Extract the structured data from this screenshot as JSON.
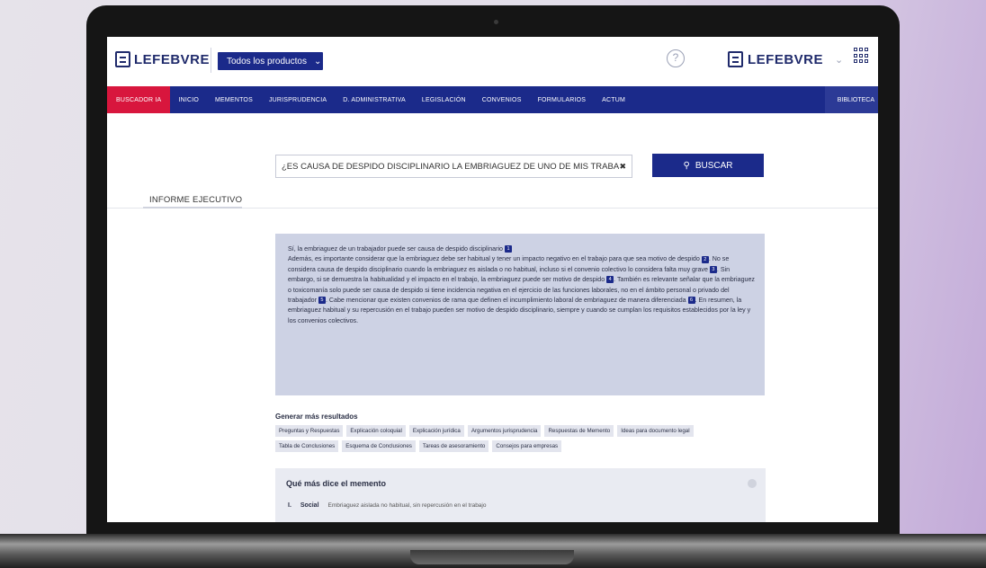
{
  "header": {
    "logo_text": "LEFEBVRE",
    "products_button": "Todos los productos",
    "help_icon": "question-icon",
    "right_logo_text": "LEFEBVRE",
    "apps_icon": "grid-icon"
  },
  "nav": {
    "items": [
      "BUSCADOR IA",
      "INICIO",
      "MEMENTOS",
      "JURISPRUDENCIA",
      "D. ADMINISTRATIVA",
      "LEGISLACIÓN",
      "CONVENIOS",
      "FORMULARIOS",
      "ACTUM"
    ],
    "right": "BIBLIOTECA"
  },
  "search": {
    "value": "¿ES CAUSA DE DESPIDO DISCIPLINARIO LA EMBRIAGUEZ DE UNO DE MIS TRABA",
    "button": "BUSCAR"
  },
  "section_title": "INFORME EJECUTIVO",
  "report": {
    "p1": "Sí, la embriaguez de un trabajador puede ser causa de despido disciplinario",
    "p2": "Además, es importante considerar que la embriaguez debe ser habitual y tener un impacto negativo en el trabajo para que sea motivo de despido",
    "p3": "No se considera causa de despido disciplinario cuando la embriaguez es aislada o no habitual, incluso si el convenio colectivo lo considera falta muy grave",
    "p4": "Sin embargo, si se demuestra la habitualidad y el impacto en el trabajo, la embriaguez puede ser motivo de despido",
    "p5": "También es relevante señalar que la embriaguez o toxicomanía solo puede ser causa de despido si tiene incidencia negativa en el ejercicio de las funciones laborales, no en el ámbito personal o privado del trabajador",
    "p6": "Cabe mencionar que existen convenios de rama que definen el incumplimiento laboral de embriaguez de manera diferenciada",
    "p7": "En resumen, la embriaguez habitual y su repercusión en el trabajo pueden ser motivo de despido disciplinario, siempre y cuando se cumplan los requisitos establecidos por la ley y los convenios colectivos."
  },
  "generate": {
    "title": "Generar más resultados",
    "chips": [
      "Preguntas y Respuestas",
      "Explicación coloquial",
      "Explicación jurídica",
      "Argumentos jurisprudencia",
      "Respuestas de Memento",
      "Ideas para documento legal",
      "Tabla de Conclusiones",
      "Esquema de Conclusiones",
      "Tareas de asesoramiento",
      "Consejos para empresas"
    ]
  },
  "memento": {
    "title": "Qué más dice el memento",
    "row_num": "I.",
    "row_label": "Social",
    "row_text": "Embriaguez aislada no habitual, sin repercusión en el trabajo"
  }
}
